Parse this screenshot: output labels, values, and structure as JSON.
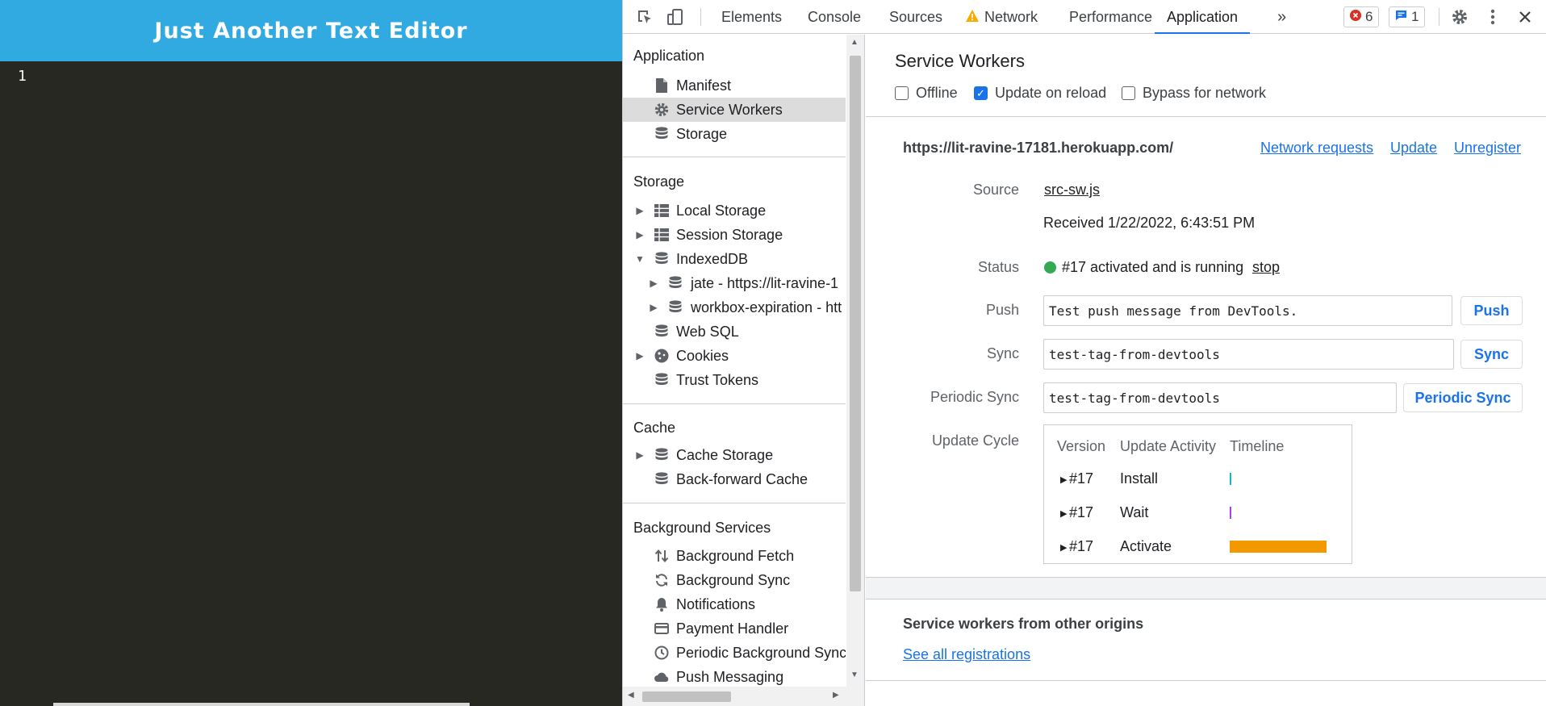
{
  "editor": {
    "title": "Just Another Text Editor",
    "line_number": "1"
  },
  "toolbar": {
    "tabs": [
      "Elements",
      "Console",
      "Sources",
      "Network",
      "Performance",
      "Application"
    ],
    "active_tab": "Application",
    "more_tabs": "»",
    "errors_count": "6",
    "messages_count": "1"
  },
  "sidebar": {
    "application_header": "Application",
    "application_items": [
      "Manifest",
      "Service Workers",
      "Storage"
    ],
    "storage_header": "Storage",
    "storage_items": [
      "Local Storage",
      "Session Storage",
      "IndexedDB",
      "jate - https://lit-ravine-1",
      "workbox-expiration - htt",
      "Web SQL",
      "Cookies",
      "Trust Tokens"
    ],
    "cache_header": "Cache",
    "cache_items": [
      "Cache Storage",
      "Back-forward Cache"
    ],
    "bg_header": "Background Services",
    "bg_items": [
      "Background Fetch",
      "Background Sync",
      "Notifications",
      "Payment Handler",
      "Periodic Background Sync",
      "Push Messaging"
    ]
  },
  "service_workers": {
    "title": "Service Workers",
    "options": {
      "offline": {
        "label": "Offline",
        "checked": false
      },
      "update_on_reload": {
        "label": "Update on reload",
        "checked": true
      },
      "bypass": {
        "label": "Bypass for network",
        "checked": false
      }
    },
    "origin": "https://lit-ravine-17181.herokuapp.com/",
    "links": {
      "network_requests": "Network requests",
      "update": "Update",
      "unregister": "Unregister"
    },
    "source_label": "Source",
    "source_file": "src-sw.js",
    "received": "Received 1/22/2022, 6:43:51 PM",
    "status_label": "Status",
    "status_text": "#17 activated and is running",
    "status_stop": "stop",
    "status_color": "#34a853",
    "push_label": "Push",
    "push_value": "Test push message from DevTools.",
    "push_button": "Push",
    "sync_label": "Sync",
    "sync_value": "test-tag-from-devtools",
    "sync_button": "Sync",
    "periodic_label": "Periodic Sync",
    "periodic_value": "test-tag-from-devtools",
    "periodic_button": "Periodic Sync",
    "update_cycle_label": "Update Cycle",
    "cycle_headers": [
      "Version",
      "Update Activity",
      "Timeline"
    ],
    "cycle_rows": [
      {
        "version": "#17",
        "activity": "Install",
        "color": "#12b5cb"
      },
      {
        "version": "#17",
        "activity": "Wait",
        "color": "#a142f4"
      },
      {
        "version": "#17",
        "activity": "Activate",
        "color": "#f29900"
      }
    ],
    "other_origins_title": "Service workers from other origins",
    "see_all": "See all registrations"
  }
}
